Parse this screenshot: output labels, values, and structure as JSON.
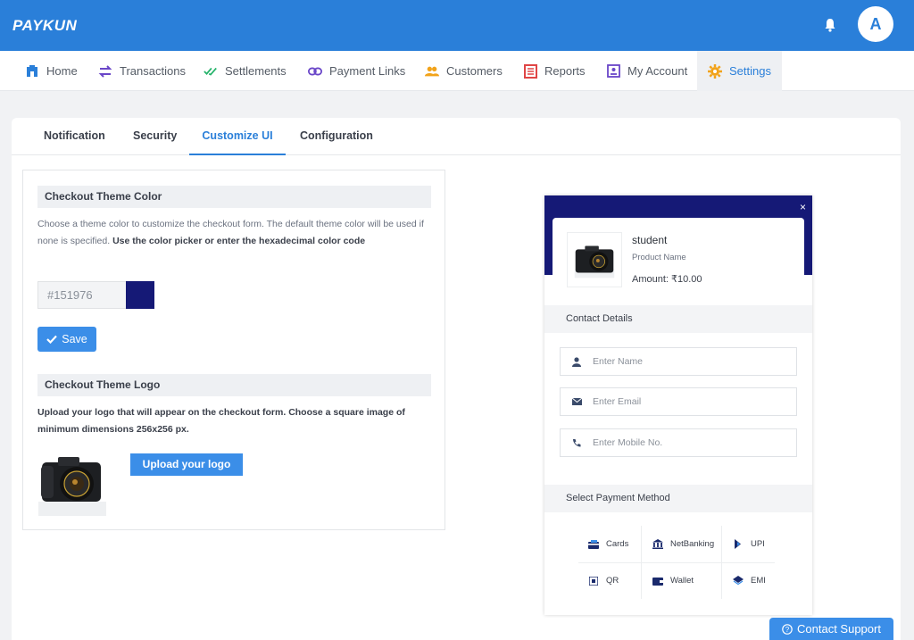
{
  "app": {
    "logo": "PAYKUN",
    "avatar_initial": "A",
    "colors": {
      "brand": "#2a7fd9",
      "button": "#3b8ee8",
      "theme": "#151976"
    }
  },
  "nav": {
    "items": [
      {
        "label": "Home",
        "icon": "home-icon"
      },
      {
        "label": "Transactions",
        "icon": "transactions-icon"
      },
      {
        "label": "Settlements",
        "icon": "settlements-icon"
      },
      {
        "label": "Payment Links",
        "icon": "link-icon"
      },
      {
        "label": "Customers",
        "icon": "customers-icon"
      },
      {
        "label": "Reports",
        "icon": "reports-icon"
      },
      {
        "label": "My Account",
        "icon": "account-icon"
      },
      {
        "label": "Settings",
        "icon": "gear-icon",
        "active": true
      }
    ]
  },
  "tabs": [
    {
      "label": "Notification"
    },
    {
      "label": "Security"
    },
    {
      "label": "Customize UI",
      "active": true
    },
    {
      "label": "Configuration"
    }
  ],
  "theme_color": {
    "heading": "Checkout Theme Color",
    "desc_plain": "Choose a theme color to customize the checkout form. The default theme color will be used if none is specified. ",
    "desc_bold": "Use the color picker or enter the hexadecimal color code",
    "value": "#151976",
    "save_label": "Save"
  },
  "theme_logo": {
    "heading": "Checkout Theme Logo",
    "desc": "Upload your logo that will appear on the checkout form. Choose a square image of minimum dimensions 256x256 px.",
    "upload_label": "Upload your logo"
  },
  "preview": {
    "close": "×",
    "product_name": "student",
    "product_sub": "Product Name",
    "amount": "Amount: ₹10.00",
    "contact_heading": "Contact Details",
    "fields": [
      {
        "placeholder": "Enter Name",
        "icon": "user-icon"
      },
      {
        "placeholder": "Enter Email",
        "icon": "envelope-icon"
      },
      {
        "placeholder": "Enter Mobile No.",
        "icon": "phone-icon"
      }
    ],
    "payment_heading": "Select Payment Method",
    "methods": [
      {
        "label": "Cards",
        "icon": "card-icon"
      },
      {
        "label": "NetBanking",
        "icon": "bank-icon"
      },
      {
        "label": "UPI",
        "icon": "upi-icon"
      },
      {
        "label": "QR",
        "icon": "qr-icon"
      },
      {
        "label": "Wallet",
        "icon": "wallet-icon"
      },
      {
        "label": "EMI",
        "icon": "emi-icon"
      }
    ]
  },
  "support": {
    "label": "Contact Support"
  }
}
